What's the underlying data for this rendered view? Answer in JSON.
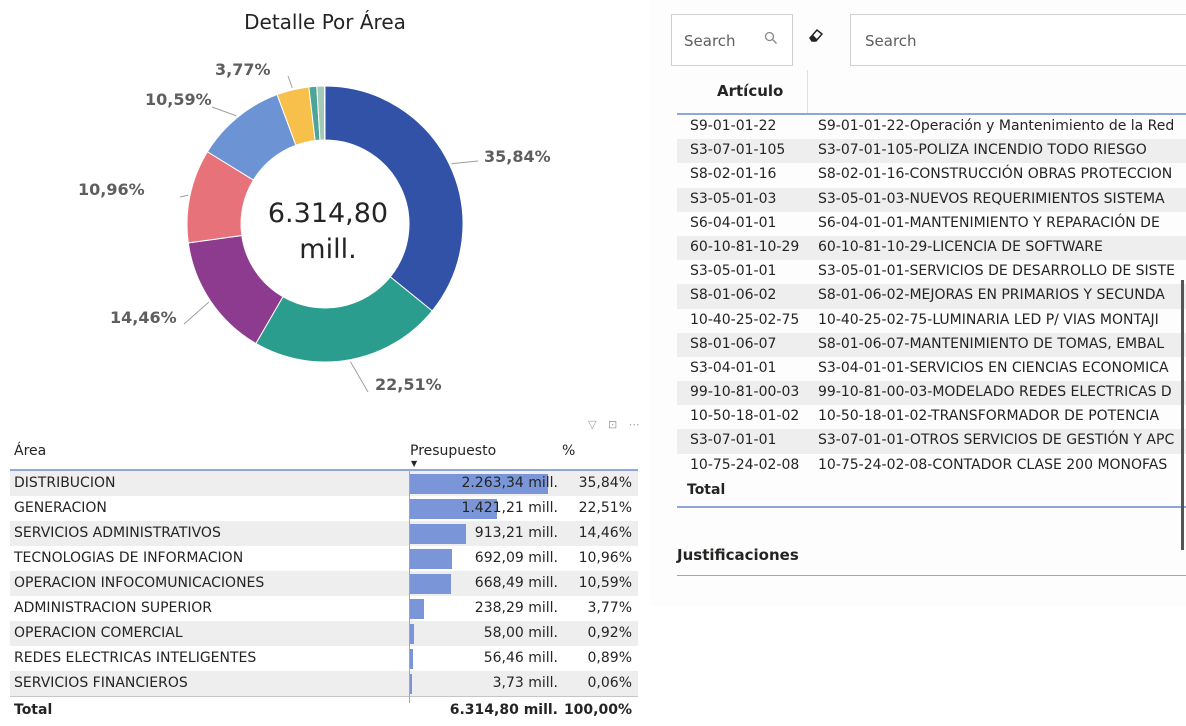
{
  "donut": {
    "title": "Detalle Por Área",
    "center_value": "6.314,80",
    "center_unit": "mill.",
    "slices": [
      {
        "label": "DISTRIBUCION",
        "value": 35.84,
        "display": "35,84%",
        "color": "#3252a8"
      },
      {
        "label": "GENERACION",
        "value": 22.51,
        "display": "22,51%",
        "color": "#2a9d8f"
      },
      {
        "label": "SERVICIOS ADMINISTRATIVOS",
        "value": 14.46,
        "display": "14,46%",
        "color": "#8d3b8f"
      },
      {
        "label": "TECNOLOGIAS DE INFORMACION",
        "value": 10.96,
        "display": "10,96%",
        "color": "#e8727a"
      },
      {
        "label": "OPERACION INFOCOMUNICACIONES",
        "value": 10.59,
        "display": "10,59%",
        "color": "#6c94d4"
      },
      {
        "label": "ADMINISTRACION SUPERIOR",
        "value": 3.77,
        "display": "3,77%",
        "color": "#f6c04b"
      },
      {
        "label": "OPERACION COMERCIAL",
        "value": 0.92,
        "display": "",
        "color": "#4fa49a"
      },
      {
        "label": "REDES ELECTRICAS INTELIGENTES",
        "value": 0.89,
        "display": "",
        "color": "#a3c9b8"
      },
      {
        "label": "SERVICIOS FINANCIEROS",
        "value": 0.06,
        "display": "",
        "color": "#c9a9e0"
      }
    ]
  },
  "area_table": {
    "header_icons": "▽ ⊡ ⋯",
    "columns": {
      "area": "Área",
      "presupuesto": "Presupuesto",
      "pct": "%"
    },
    "sort_indicator": "▼",
    "rows": [
      {
        "area": "DISTRIBUCION",
        "presupuesto": "2.263,34 mill.",
        "pct": "35,84%",
        "bar": 1.0
      },
      {
        "area": "GENERACION",
        "presupuesto": "1.421,21 mill.",
        "pct": "22,51%",
        "bar": 0.628
      },
      {
        "area": "SERVICIOS ADMINISTRATIVOS",
        "presupuesto": "913,21 mill.",
        "pct": "14,46%",
        "bar": 0.403
      },
      {
        "area": "TECNOLOGIAS DE INFORMACION",
        "presupuesto": "692,09 mill.",
        "pct": "10,96%",
        "bar": 0.306
      },
      {
        "area": "OPERACION INFOCOMUNICACIONES",
        "presupuesto": "668,49 mill.",
        "pct": "10,59%",
        "bar": 0.295
      },
      {
        "area": "ADMINISTRACION SUPERIOR",
        "presupuesto": "238,29 mill.",
        "pct": "3,77%",
        "bar": 0.105
      },
      {
        "area": "OPERACION COMERCIAL",
        "presupuesto": "58,00 mill.",
        "pct": "0,92%",
        "bar": 0.026
      },
      {
        "area": "REDES ELECTRICAS INTELIGENTES",
        "presupuesto": "56,46 mill.",
        "pct": "0,89%",
        "bar": 0.025
      },
      {
        "area": "SERVICIOS FINANCIEROS",
        "presupuesto": "3,73 mill.",
        "pct": "0,06%",
        "bar": 0.002
      }
    ],
    "total": {
      "label": "Total",
      "presupuesto": "6.314,80 mill.",
      "pct": "100,00%"
    }
  },
  "filters": {
    "search1_placeholder": "Search",
    "search1_icon": "search-icon",
    "eraser_icon": "eraser-icon",
    "search2_placeholder": "Search"
  },
  "articulo_table": {
    "header": "Artículo",
    "rows": [
      {
        "code": "S9-01-01-22",
        "desc": "S9-01-01-22-Operación y Mantenimiento de la Red"
      },
      {
        "code": "S3-07-01-105",
        "desc": "S3-07-01-105-POLIZA INCENDIO TODO RIESGO"
      },
      {
        "code": "S8-02-01-16",
        "desc": "S8-02-01-16-CONSTRUCCIÓN OBRAS PROTECCION"
      },
      {
        "code": "S3-05-01-03",
        "desc": "S3-05-01-03-NUEVOS REQUERIMIENTOS SISTEMA"
      },
      {
        "code": "S6-04-01-01",
        "desc": "S6-04-01-01-MANTENIMIENTO Y REPARACIÓN DE"
      },
      {
        "code": "60-10-81-10-29",
        "desc": "60-10-81-10-29-LICENCIA DE SOFTWARE"
      },
      {
        "code": "S3-05-01-01",
        "desc": "S3-05-01-01-SERVICIOS DE DESARROLLO DE SISTE"
      },
      {
        "code": "S8-01-06-02",
        "desc": "S8-01-06-02-MEJORAS EN PRIMARIOS Y SECUNDA"
      },
      {
        "code": "10-40-25-02-75",
        "desc": "10-40-25-02-75-LUMINARIA LED P/ VIAS MONTAJI"
      },
      {
        "code": "S8-01-06-07",
        "desc": "S8-01-06-07-MANTENIMIENTO DE TOMAS, EMBAL"
      },
      {
        "code": "S3-04-01-01",
        "desc": "S3-04-01-01-SERVICIOS EN CIENCIAS ECONOMICA"
      },
      {
        "code": "99-10-81-00-03",
        "desc": "99-10-81-00-03-MODELADO REDES ELECTRICAS D"
      },
      {
        "code": "10-50-18-01-02",
        "desc": "10-50-18-01-02-TRANSFORMADOR DE POTENCIA"
      },
      {
        "code": "S3-07-01-01",
        "desc": "S3-07-01-01-OTROS SERVICIOS DE GESTIÓN Y APC"
      },
      {
        "code": "10-75-24-02-08",
        "desc": "10-75-24-02-08-CONTADOR CLASE 200 MONOFAS"
      }
    ],
    "total_label": "Total"
  },
  "justificaciones": {
    "label": "Justificaciones"
  }
}
